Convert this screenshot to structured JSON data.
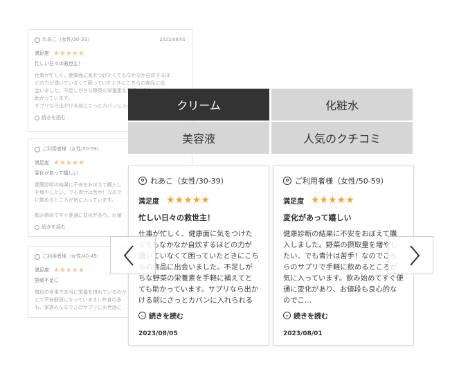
{
  "background_reviews": [
    {
      "user": "れあこ（女性/30-39）",
      "date": "2023/08/05",
      "satisfaction_label": "満足度",
      "stars": "★★★★★",
      "title": "忙しい日々の救世主！",
      "body": [
        "仕事が忙しく、健康面に気をつけたくてもなかなか自炊するほ",
        "どの力が湧いていなくて困っていたときにこちらの商品に出",
        "会いました。不足しがちな野菜の栄養素を手軽に補えてとても",
        "助かっています。",
        "サプリなら出かける前にさっとカバンに入れられるので出先"
      ],
      "more": "続きを読む"
    },
    {
      "user": "ご利用者様（女性/50-59）",
      "satisfaction_label": "満足度",
      "stars": "★★★★★",
      "title": "変化があって嬉しい",
      "body": [
        "健康診断の結果に不安をおぼえて購入し",
        "を増やしたい、でも青汁は苦手！なので",
        "に飲めるところが気に入っています。",
        "",
        "飲み始めてすぐ便通に変化があり、お値"
      ],
      "more": "続きを読む"
    },
    {
      "user": "ご利用者様（女性/40-49）",
      "satisfaction_label": "満足度",
      "stars": "★★★★★",
      "title": "野菜不足に",
      "body": [
        "普段の食事で本当に栄養を摂れているのか",
        "とで不安解消になっています！外食の多",
        "も、家族みんなでこのサプリにお世話に"
      ]
    }
  ],
  "tabs": [
    {
      "label": "クリーム",
      "active": true
    },
    {
      "label": "化粧水",
      "active": false
    },
    {
      "label": "美容液",
      "active": false
    },
    {
      "label": "人気のクチコミ",
      "active": false
    }
  ],
  "reviews": [
    {
      "user": "れあこ（女性/30-39）",
      "satisfaction_label": "満足度",
      "stars": "★★★★★",
      "title": "忙しい日々の救世主！",
      "body": "仕事が忙しく、健康面に気をつけたくてもなかなか自炊するほどの力が湧いていなくて困っていたときにこちらの商品に出会いました。不足しがちな野菜の栄養素を手軽に補えてとても助かっています。サプリなら出かける前にさっとカバンに入れられるので出先…",
      "more": "続きを読む",
      "date": "2023/08/05"
    },
    {
      "user": "ご利用者様（女性/50-59）",
      "satisfaction_label": "満足度",
      "stars": "★★★★★",
      "title": "変化があって嬉しい",
      "body": "健康診断の結果に不安をおぼえて購入しました。野菜の摂取量を増やしたい、でも青汁は苦手！なのでこちらのサプリで手軽に飲めるところが気に入っています。飲み始めてすぐ便通に変化があり、お値段も良心的なのでこ…",
      "more": "続きを読む",
      "date": "2023/08/01"
    }
  ],
  "icons": {
    "user": "user-circle-icon",
    "more": "chevron-down-circle-icon",
    "prev": "chevron-left-icon",
    "next": "chevron-right-icon"
  },
  "colors": {
    "active_tab": "#333333",
    "inactive_tab": "#d6d6d6",
    "star": "#f5a623"
  }
}
